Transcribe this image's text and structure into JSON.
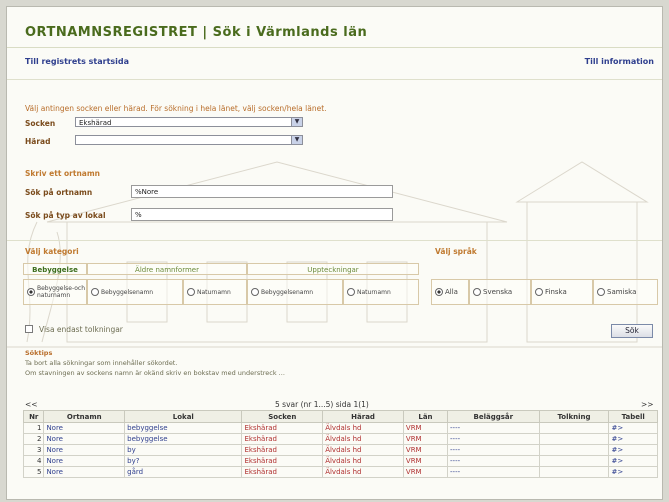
{
  "header": {
    "title": "ORTNAMNSREGISTRET  |  Sök i Värmlands län"
  },
  "nav": {
    "home_link": "Till registrets startsida",
    "info_link": "Till information"
  },
  "search": {
    "instruction": "Välj antingen socken eller härad. För sökning i hela länet, välj socken/hela länet.",
    "socken_label": "Socken",
    "socken_value": "Ekshärad",
    "harad_label": "Härad",
    "harad_value": "",
    "ortnamn_title": "Skriv ett ortnamn",
    "ortnamn_label": "Sök på ortnamn",
    "ortnamn_value": "%Nore",
    "lokal_label": "Sök på typ av lokal",
    "lokal_value": "%"
  },
  "categories": {
    "kategori_label": "Välj kategori",
    "sprak_label": "Välj språk",
    "tabs": [
      "Bebyggelse",
      "Äldre namnformer",
      "Uppteckningar"
    ],
    "options": [
      {
        "label": "Bebyggelse-och naturnamn",
        "checked": true
      },
      {
        "label": "Bebyggelsenamn",
        "checked": false
      },
      {
        "label": "Naturnamn",
        "checked": false
      },
      {
        "label": "Bebyggelsenamn",
        "checked": false
      },
      {
        "label": "Naturnamn",
        "checked": false
      }
    ],
    "languages": [
      {
        "label": "Alla",
        "checked": true
      },
      {
        "label": "Svenska",
        "checked": false
      },
      {
        "label": "Finska",
        "checked": false
      },
      {
        "label": "Samiska",
        "checked": false
      }
    ]
  },
  "tolkningar": {
    "label": "Visa endast tolkningar",
    "checked": false
  },
  "sok_button": "Sök",
  "help": {
    "title": "Söktips",
    "line1": "Ta bort alla sökningar som innehåller sökordet.",
    "line2": "Om stavningen av sockens namn är okänd skriv en bokstav med understreck ..."
  },
  "pager": {
    "prev": "<<",
    "summary": "5 svar (nr 1...5) sida 1(1)",
    "next": ">>"
  },
  "table": {
    "headers": [
      "Nr",
      "Ortnamn",
      "Lokal",
      "Socken",
      "Härad",
      "Län",
      "Beläggsår",
      "Tolkning",
      "Tabell"
    ],
    "rows": [
      {
        "nr": "1",
        "ortnamn": "Nore",
        "lokal": "bebyggelse",
        "socken": "Ekshärad",
        "harad": "Älvdals hd",
        "lan": "VRM",
        "belaggsar": "----",
        "tolkning": "",
        "tabell": "#>"
      },
      {
        "nr": "2",
        "ortnamn": "Nore",
        "lokal": "bebyggelse",
        "socken": "Ekshärad",
        "harad": "Älvdals hd",
        "lan": "VRM",
        "belaggsar": "----",
        "tolkning": "",
        "tabell": "#>"
      },
      {
        "nr": "3",
        "ortnamn": "Nore",
        "lokal": "by",
        "socken": "Ekshärad",
        "harad": "Älvdals hd",
        "lan": "VRM",
        "belaggsar": "----",
        "tolkning": "",
        "tabell": "#>"
      },
      {
        "nr": "4",
        "ortnamn": "Nore",
        "lokal": "by?",
        "socken": "Ekshärad",
        "harad": "Älvdals hd",
        "lan": "VRM",
        "belaggsar": "----",
        "tolkning": "",
        "tabell": "#>"
      },
      {
        "nr": "5",
        "ortnamn": "Nore",
        "lokal": "gård",
        "socken": "Ekshärad",
        "harad": "Älvdals hd",
        "lan": "VRM",
        "belaggsar": "----",
        "tolkning": "",
        "tabell": "#>"
      }
    ]
  },
  "colors": {
    "title_green": "#4a6b1d",
    "link_blue": "#2f3f8e",
    "accent_orange": "#c07a30",
    "cell_red": "#b03030"
  }
}
